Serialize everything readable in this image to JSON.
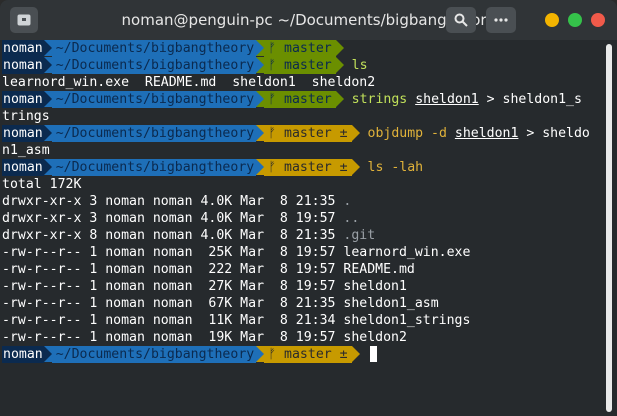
{
  "window": {
    "title": "noman@penguin-pc ~/Documents/bigbangtheory"
  },
  "titlebar_icons": [
    "terminal-icon",
    "search-icon",
    "more-icon"
  ],
  "colors": {
    "close": "#f05a4a",
    "maximize": "#35c24a",
    "minimize": "#f3b400",
    "user_bg": "#0b2a4f",
    "dir_bg": "#1e6fb8",
    "git_clean": "#6b8f00",
    "git_dirty": "#c79a00"
  },
  "prompt": {
    "user": "noman",
    "dir": "~/Documents/bigbangtheory",
    "branch_clean": "ᚠ master",
    "branch_dirty": "ᚠ master ±"
  },
  "lines": [
    {
      "kind": "prompt",
      "state": "clean",
      "cmd": ""
    },
    {
      "kind": "prompt",
      "state": "clean",
      "cmd": "ls"
    },
    {
      "kind": "out",
      "text": "learnord_win.exe  README.md  sheldon1  sheldon2"
    },
    {
      "kind": "prompt",
      "state": "clean",
      "cmd_a": "strings ",
      "cmd_ul": "sheldon1",
      "cmd_b": " > sheldon1_s"
    },
    {
      "kind": "out",
      "text": "trings"
    },
    {
      "kind": "prompt",
      "state": "dirty",
      "cmd_a": "objdump -d ",
      "cmd_ul": "sheldon1",
      "cmd_b": " > sheldo"
    },
    {
      "kind": "out",
      "text": "n1_asm"
    },
    {
      "kind": "prompt",
      "state": "dirty",
      "cmd": "ls -lah"
    },
    {
      "kind": "out",
      "text": "total 172K"
    },
    {
      "kind": "ls",
      "perm": "drwxr-xr-x 3 noman noman 4.0K Mar  8 21:35 ",
      "name": "."
    },
    {
      "kind": "ls",
      "perm": "drwxr-xr-x 3 noman noman 4.0K Mar  8 19:57 ",
      "name": ".."
    },
    {
      "kind": "ls",
      "perm": "drwxr-xr-x 8 noman noman 4.0K Mar  8 21:35 ",
      "name": ".git"
    },
    {
      "kind": "out",
      "text": "-rw-r--r-- 1 noman noman  25K Mar  8 19:57 learnord_win.exe"
    },
    {
      "kind": "out",
      "text": "-rw-r--r-- 1 noman noman  222 Mar  8 19:57 README.md"
    },
    {
      "kind": "out",
      "text": "-rw-r--r-- 1 noman noman  27K Mar  8 19:57 sheldon1"
    },
    {
      "kind": "out",
      "text": "-rw-r--r-- 1 noman noman  67K Mar  8 21:35 sheldon1_asm"
    },
    {
      "kind": "out",
      "text": "-rw-r--r-- 1 noman noman  11K Mar  8 21:34 sheldon1_strings"
    },
    {
      "kind": "out",
      "text": "-rw-r--r-- 1 noman noman  19K Mar  8 19:57 sheldon2"
    },
    {
      "kind": "prompt",
      "state": "dirty",
      "cmd": "",
      "cursor": true
    }
  ]
}
